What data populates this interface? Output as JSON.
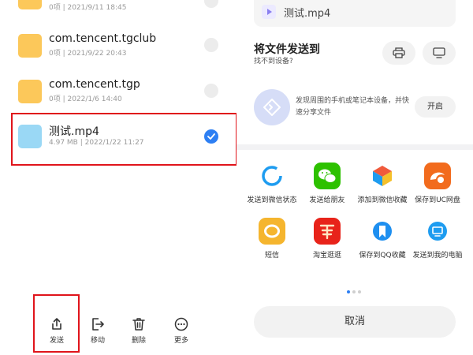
{
  "file_list": {
    "items": [
      {
        "name": "",
        "meta": "0项  |  2021/9/11 18:45",
        "type": "folder",
        "selected": false
      },
      {
        "name": "com.tencent.tgclub",
        "meta": "0项  |  2021/9/22 20:43",
        "type": "folder",
        "selected": false
      },
      {
        "name": "com.tencent.tgp",
        "meta": "0项  |  2022/1/6 14:40",
        "type": "folder",
        "selected": false
      },
      {
        "name": "测试.mp4",
        "meta": "4.97 MB  |  2022/1/22 11:27",
        "type": "video",
        "selected": true
      }
    ]
  },
  "bottom_bar": {
    "send": "发送",
    "move": "移动",
    "delete": "删除",
    "more": "更多"
  },
  "share_sheet": {
    "file_name": "测试.mp4",
    "send_to_title": "将文件发送到",
    "send_to_sub": "找不到设备?",
    "nearby_text": "发现周围的手机或笔记本设备，并快速分享文件",
    "open_button": "开启",
    "apps": [
      {
        "label": "发送到微信状态",
        "icon": "wechat-status-icon",
        "color": "#1e9cf0"
      },
      {
        "label": "发送给朋友",
        "icon": "wechat-icon",
        "color": "#2dc100"
      },
      {
        "label": "添加到微信收藏",
        "icon": "wechat-favorites-icon",
        "color": "#f5a623"
      },
      {
        "label": "保存到UC网盘",
        "icon": "uc-icon",
        "color": "#f26b1d"
      },
      {
        "label": "短信",
        "icon": "sms-icon",
        "color": "#f5b52e"
      },
      {
        "label": "淘宝逛逛",
        "icon": "taobao-icon",
        "color": "#e8231a"
      },
      {
        "label": "保存到QQ收藏",
        "icon": "qq-favorites-icon",
        "color": "#1e8ff0"
      },
      {
        "label": "发送到我的电脑",
        "icon": "my-computer-icon",
        "color": "#1e9cf0"
      }
    ],
    "page_indicator": {
      "count": 3,
      "active": 1
    },
    "cancel": "取消"
  },
  "colors": {
    "accent": "#2d7ff3",
    "highlight_border": "#e0141b",
    "folder": "#fcc85a",
    "video": "#9ad8f5"
  }
}
